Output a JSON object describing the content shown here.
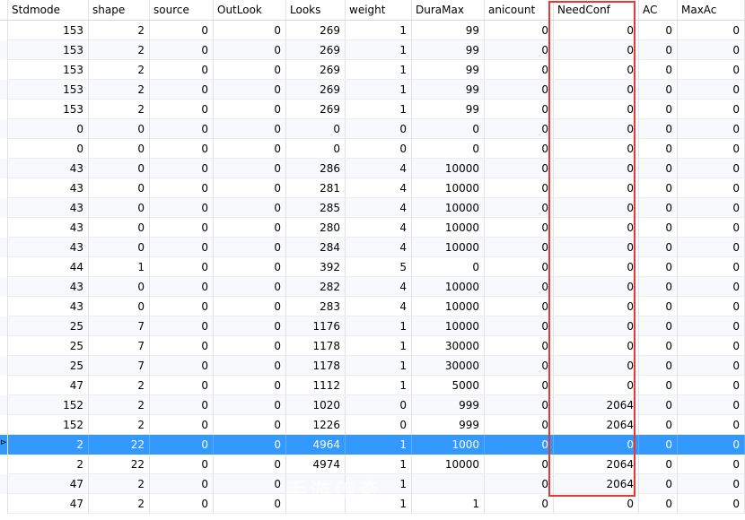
{
  "grid": {
    "columns": [
      "Stdmode",
      "shape",
      "source",
      "OutLook",
      "Looks",
      "weight",
      "DuraMax",
      "anicount",
      "NeedConf",
      "AC",
      "MaxAc"
    ],
    "selected_row": 21,
    "highlighted_column": "NeedConf",
    "colors": {
      "selection": "#3399ff",
      "highlight_border": "#e53935",
      "alt_row": "#f7f9fd"
    },
    "rows": [
      [
        "153",
        "2",
        "0",
        "0",
        "269",
        "1",
        "99",
        "0",
        "0",
        "0",
        "0"
      ],
      [
        "153",
        "2",
        "0",
        "0",
        "269",
        "1",
        "99",
        "0",
        "0",
        "0",
        "0"
      ],
      [
        "153",
        "2",
        "0",
        "0",
        "269",
        "1",
        "99",
        "0",
        "0",
        "0",
        "0"
      ],
      [
        "153",
        "2",
        "0",
        "0",
        "269",
        "1",
        "99",
        "0",
        "0",
        "0",
        "0"
      ],
      [
        "153",
        "2",
        "0",
        "0",
        "269",
        "1",
        "99",
        "0",
        "0",
        "0",
        "0"
      ],
      [
        "0",
        "0",
        "0",
        "0",
        "0",
        "0",
        "0",
        "0",
        "0",
        "0",
        "0"
      ],
      [
        "0",
        "0",
        "0",
        "0",
        "0",
        "0",
        "0",
        "0",
        "0",
        "0",
        "0"
      ],
      [
        "43",
        "0",
        "0",
        "0",
        "286",
        "4",
        "10000",
        "0",
        "0",
        "0",
        "0"
      ],
      [
        "43",
        "0",
        "0",
        "0",
        "281",
        "4",
        "10000",
        "0",
        "0",
        "0",
        "0"
      ],
      [
        "43",
        "0",
        "0",
        "0",
        "285",
        "4",
        "10000",
        "0",
        "0",
        "0",
        "0"
      ],
      [
        "43",
        "0",
        "0",
        "0",
        "280",
        "4",
        "10000",
        "0",
        "0",
        "0",
        "0"
      ],
      [
        "43",
        "0",
        "0",
        "0",
        "284",
        "4",
        "10000",
        "0",
        "0",
        "0",
        "0"
      ],
      [
        "44",
        "1",
        "0",
        "0",
        "392",
        "5",
        "0",
        "0",
        "0",
        "0",
        "0"
      ],
      [
        "43",
        "0",
        "0",
        "0",
        "282",
        "4",
        "10000",
        "0",
        "0",
        "0",
        "0"
      ],
      [
        "43",
        "0",
        "0",
        "0",
        "283",
        "4",
        "10000",
        "0",
        "0",
        "0",
        "0"
      ],
      [
        "25",
        "7",
        "0",
        "0",
        "1176",
        "1",
        "10000",
        "0",
        "0",
        "0",
        "0"
      ],
      [
        "25",
        "7",
        "0",
        "0",
        "1178",
        "1",
        "30000",
        "0",
        "0",
        "0",
        "0"
      ],
      [
        "25",
        "7",
        "0",
        "0",
        "1178",
        "1",
        "30000",
        "0",
        "0",
        "0",
        "0"
      ],
      [
        "47",
        "2",
        "0",
        "0",
        "1112",
        "1",
        "5000",
        "0",
        "0",
        "0",
        "0"
      ],
      [
        "152",
        "2",
        "0",
        "0",
        "1020",
        "0",
        "999",
        "0",
        "2064",
        "0",
        "0"
      ],
      [
        "152",
        "2",
        "0",
        "0",
        "1226",
        "0",
        "999",
        "0",
        "2064",
        "0",
        "0"
      ],
      [
        "2",
        "22",
        "0",
        "0",
        "4964",
        "1",
        "1000",
        "0",
        "0",
        "0",
        "0"
      ],
      [
        "2",
        "22",
        "0",
        "0",
        "4974",
        "1",
        "10000",
        "0",
        "2064",
        "0",
        "0"
      ],
      [
        "47",
        "2",
        "0",
        "0",
        "",
        "1",
        "",
        "0",
        "2064",
        "0",
        "0"
      ],
      [
        "47",
        "2",
        "0",
        "0",
        "",
        "1",
        "1",
        "0",
        "0",
        "0",
        "0"
      ]
    ]
  },
  "selection_marker": "⊳",
  "watermark_text": "手游传奇"
}
